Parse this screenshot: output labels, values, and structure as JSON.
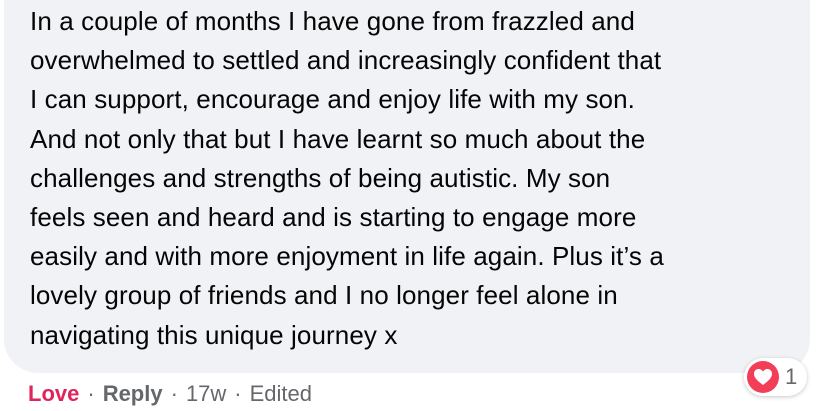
{
  "comment": {
    "lines": [
      "In a couple of months I have gone from frazzled and",
      "overwhelmed to settled and increasingly confident that",
      "I can support, encourage and enjoy life with my son.",
      "And not only that but I have learnt so much about the",
      "challenges and strengths of being autistic. My son",
      "feels seen and heard and is starting to engage more",
      "easily and with more enjoyment in life again. Plus it’s a",
      "lovely group of friends and I no longer feel alone in",
      "navigating this unique journey x"
    ]
  },
  "actions": {
    "love_label": "Love",
    "separator": "·",
    "reply_label": "Reply",
    "time": "17w",
    "edited": "Edited"
  },
  "reaction": {
    "icon": "heart-icon",
    "count": "1",
    "color": "#f33e58"
  },
  "colors": {
    "bubble_bg": "#f0f2f5",
    "text": "#050505",
    "meta": "#65676b",
    "love_active": "#e0245e"
  }
}
